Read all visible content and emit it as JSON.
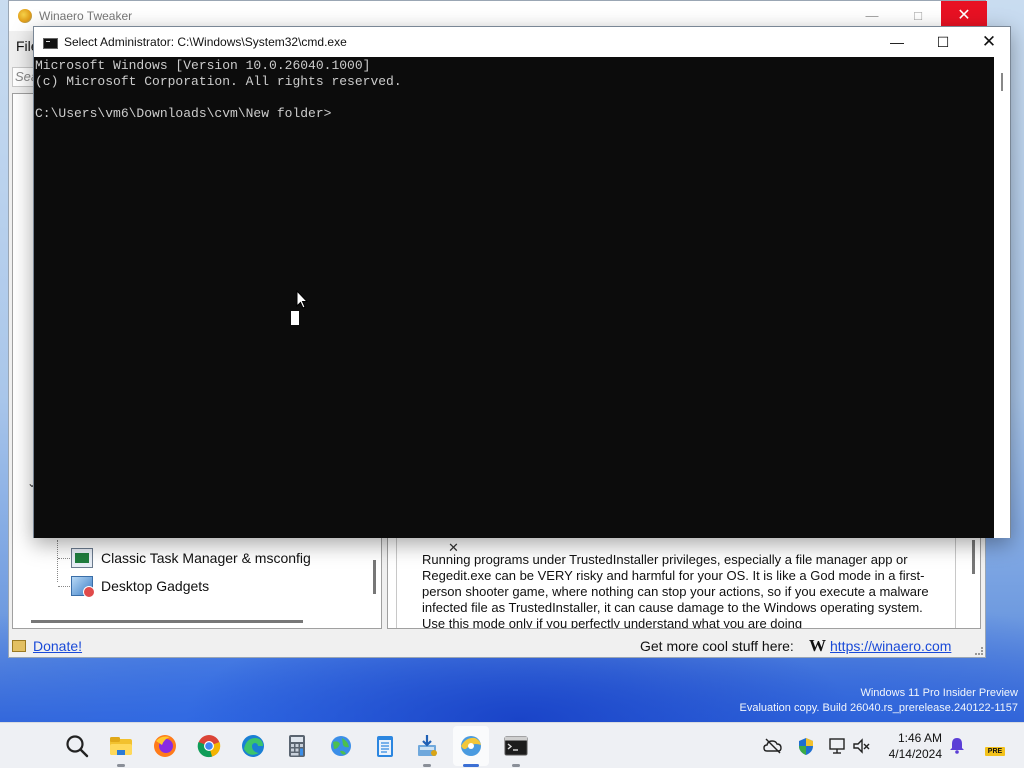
{
  "desktop": {
    "watermark_line1": "Windows 11 Pro Insider Preview",
    "watermark_line2": "Evaluation copy. Build 26040.rs_prerelease.240122-1157"
  },
  "winaero": {
    "title": "Winaero Tweaker",
    "menu_file": "File",
    "search_placeholder": "Search",
    "tree_items": [
      {
        "label": "Classic Task Manager & msconfig",
        "icon": "task-manager-icon"
      },
      {
        "label": "Desktop Gadgets",
        "icon": "gadgets-icon"
      }
    ],
    "description": "Running programs under TrustedInstaller privileges, especially a file manager app or Regedit.exe can be VERY risky and harmful for your OS. It is like a God mode in a first-person shooter game, where nothing can stop your actions, so if you execute a malware infected file as TrustedInstaller, it can cause damage to the Windows operating system. Use this mode only if you perfectly understand what you are doing",
    "donate_label": "Donate!",
    "cool_stuff_label": "Get more cool stuff here:",
    "winaero_logo_letter": "W",
    "site_link": "https://winaero.com"
  },
  "cmd": {
    "title": "Select Administrator: C:\\Windows\\System32\\cmd.exe",
    "lines": [
      "Microsoft Windows [Version 10.0.26040.1000]",
      "(c) Microsoft Corporation. All rights reserved.",
      "",
      "C:\\Users\\vm6\\Downloads\\cvm\\New folder>"
    ]
  },
  "taskbar": {
    "apps": [
      "search-icon",
      "file-explorer-icon",
      "firefox-icon",
      "chrome-icon",
      "edge-icon",
      "calculator-icon",
      "network-globe-icon",
      "notepad-icon",
      "installer-icon",
      "winaero-tweaker-icon",
      "terminal-icon"
    ],
    "time": "1:46 AM",
    "date": "4/14/2024",
    "badge": "PRE"
  },
  "colors": {
    "console_bg": "#0c0c0c",
    "console_text": "#cccccc",
    "link": "#1a4ad8",
    "close_red": "#e81123"
  }
}
